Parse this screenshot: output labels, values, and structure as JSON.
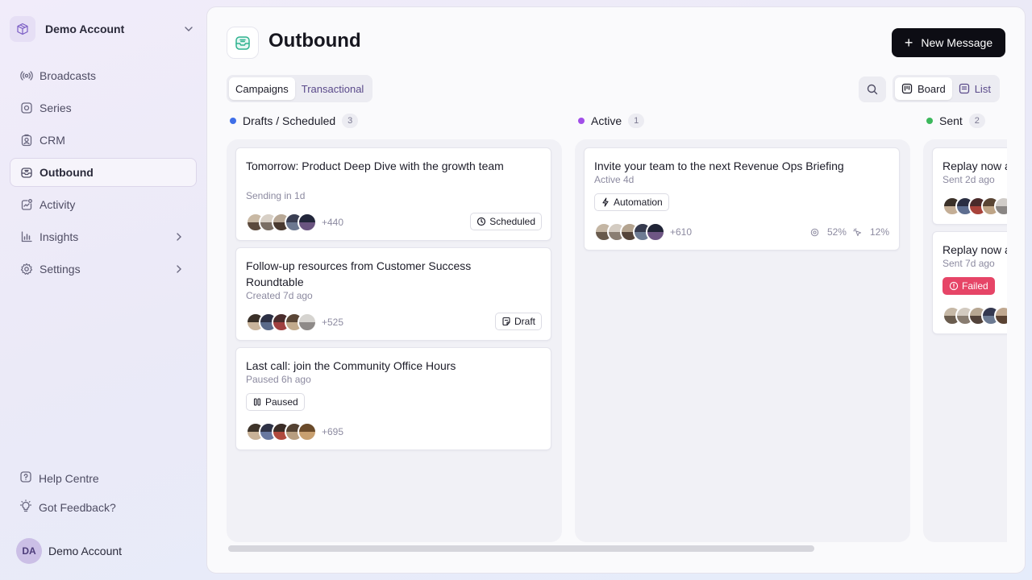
{
  "sidebar": {
    "account_name": "Demo Account",
    "nav": [
      {
        "label": "Broadcasts",
        "icon": "broadcast-icon"
      },
      {
        "label": "Series",
        "icon": "series-icon"
      },
      {
        "label": "CRM",
        "icon": "crm-icon"
      },
      {
        "label": "Outbound",
        "icon": "outbound-icon",
        "active": true
      },
      {
        "label": "Activity",
        "icon": "activity-icon"
      },
      {
        "label": "Insights",
        "icon": "insights-icon"
      },
      {
        "label": "Settings",
        "icon": "settings-icon"
      }
    ],
    "help_label": "Help Centre",
    "feedback_label": "Got Feedback?",
    "user_initials": "DA",
    "user_name": "Demo Account"
  },
  "header": {
    "title": "Outbound",
    "new_message_label": "New Message"
  },
  "tabs": [
    "Campaigns",
    "Transactional"
  ],
  "view_toggle": {
    "board": "Board",
    "list": "List"
  },
  "columns": [
    {
      "title": "Drafts / Scheduled",
      "count": "3",
      "color": "#3f6fe8",
      "cards": [
        {
          "title": "Tomorrow: Product Deep Dive with the growth team",
          "sub": "Sending in 1d",
          "more": "+440",
          "status": "Scheduled"
        },
        {
          "title": "Follow-up resources from Customer Success Roundtable",
          "sub": "Created 7d ago",
          "more": "+525",
          "status": "Draft"
        },
        {
          "title": "Last call: join the Community Office Hours",
          "sub": "Paused 6h ago",
          "more": "+695",
          "status": "Paused"
        }
      ]
    },
    {
      "title": "Active",
      "count": "1",
      "color": "#a14ee8",
      "cards": [
        {
          "title": "Invite your team to the next Revenue Ops Briefing",
          "sub": "Active 4d",
          "tag": "Automation",
          "more": "+610",
          "open_rate": "52%",
          "click_rate": "12%"
        }
      ]
    },
    {
      "title": "Sent",
      "count": "2",
      "color": "#3cb85c",
      "cards": [
        {
          "title": "Replay now a",
          "sub": "Sent 2d ago"
        },
        {
          "title": "Replay now a",
          "sub": "Sent 7d ago",
          "status": "Failed"
        }
      ]
    }
  ],
  "colors": {
    "accent": "#5a4a8a",
    "failed": "#e64567",
    "primary_button": "#0d0d14"
  }
}
